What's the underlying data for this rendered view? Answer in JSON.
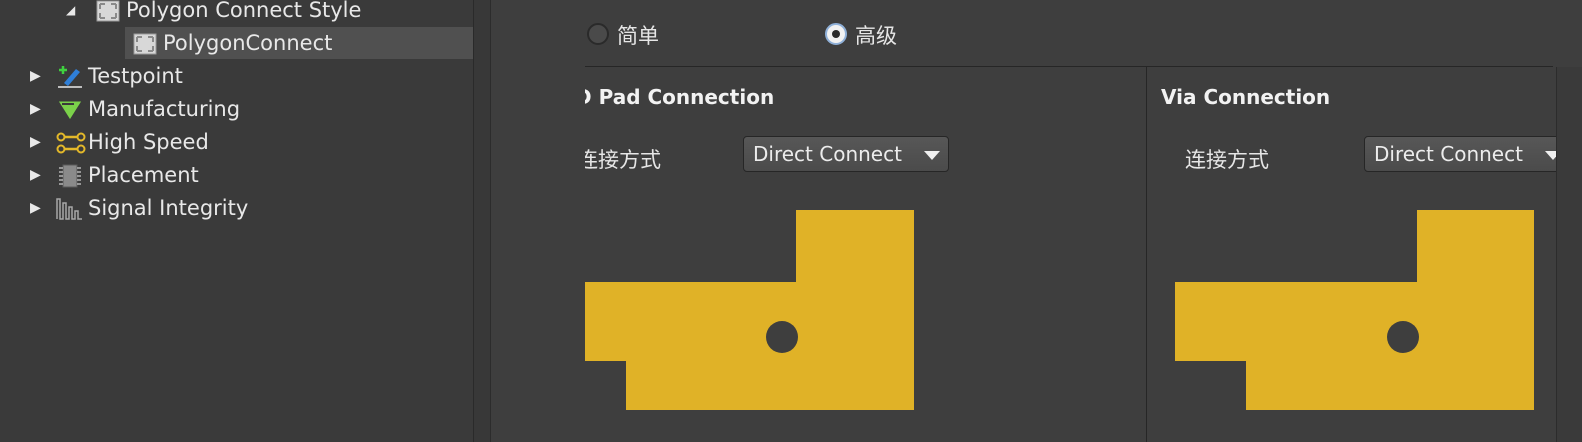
{
  "tree": {
    "items": [
      {
        "label": "Polygon Connect Style",
        "expanded": true,
        "icon": "rule-category-icon"
      },
      {
        "label": "PolygonConnect",
        "selected": true,
        "icon": "rule-icon"
      },
      {
        "label": "Testpoint",
        "expanded": false,
        "icon": "testpoint-icon"
      },
      {
        "label": "Manufacturing",
        "expanded": false,
        "icon": "manufacturing-icon"
      },
      {
        "label": "High Speed",
        "expanded": false,
        "icon": "high-speed-icon"
      },
      {
        "label": "Placement",
        "expanded": false,
        "icon": "placement-icon"
      },
      {
        "label": "Signal Integrity",
        "expanded": false,
        "icon": "signal-integrity-icon"
      }
    ]
  },
  "mode": {
    "simple_label": "简单",
    "advanced_label": "高级",
    "selected": "advanced"
  },
  "pad_section": {
    "title": "Pad Connection",
    "truncated_prefix": "D",
    "field_label": "连接方式",
    "connect_value": "Direct Connect"
  },
  "via_section": {
    "title": "Via Connection",
    "field_label": "连接方式",
    "connect_value": "Direct Connect"
  },
  "colors": {
    "copper": "#e0b227",
    "background": "#3e3e3e",
    "tree_selected": "#505050"
  }
}
